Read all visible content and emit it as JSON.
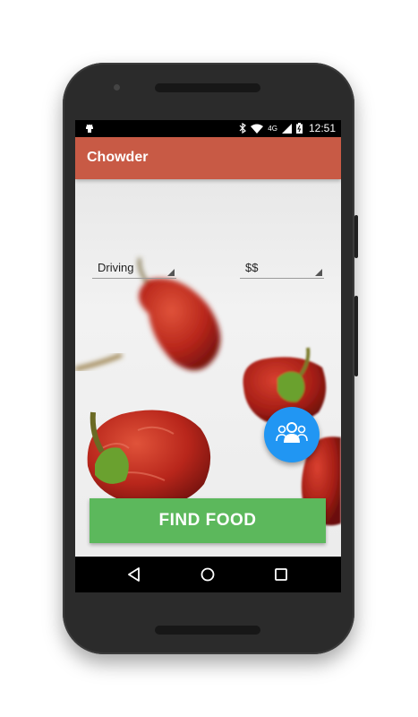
{
  "statusbar": {
    "time": "12:51",
    "network_label": "4G",
    "icons": [
      "android-debug-icon",
      "bluetooth-icon",
      "wifi-icon",
      "signal-icon",
      "battery-icon"
    ]
  },
  "appbar": {
    "title": "Chowder",
    "color": "#c85a45"
  },
  "filters": {
    "travel_mode": "Driving",
    "price": "$$"
  },
  "fab": {
    "icon": "group-icon",
    "color": "#2196f3"
  },
  "action": {
    "label": "FIND FOOD",
    "color": "#5cb85c"
  },
  "navbar": {
    "icons": [
      "back-icon",
      "home-icon",
      "recents-icon"
    ]
  }
}
